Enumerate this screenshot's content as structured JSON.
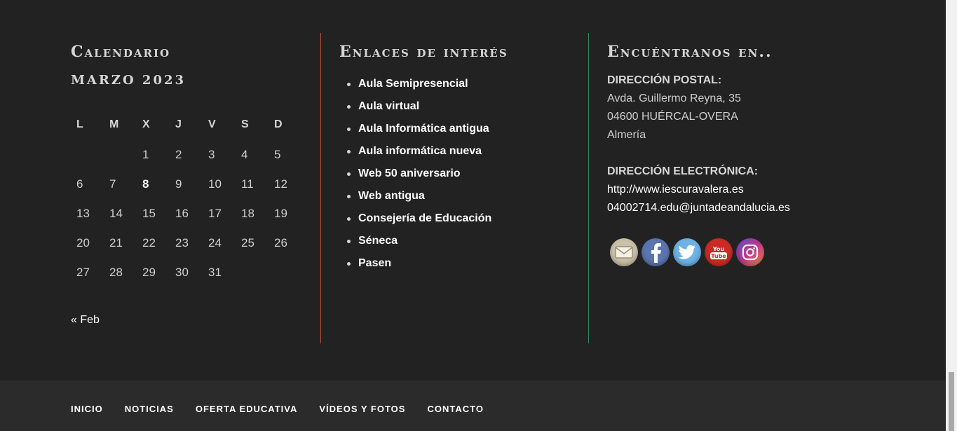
{
  "calendar": {
    "title": "Calendario",
    "caption": "MARZO 2023",
    "weekdays": [
      "L",
      "M",
      "X",
      "J",
      "V",
      "S",
      "D"
    ],
    "weeks": [
      [
        "",
        "",
        "1",
        "2",
        "3",
        "4",
        "5"
      ],
      [
        "6",
        "7",
        "8",
        "9",
        "10",
        "11",
        "12"
      ],
      [
        "13",
        "14",
        "15",
        "16",
        "17",
        "18",
        "19"
      ],
      [
        "20",
        "21",
        "22",
        "23",
        "24",
        "25",
        "26"
      ],
      [
        "27",
        "28",
        "29",
        "30",
        "31",
        "",
        ""
      ]
    ],
    "today": "8",
    "prev_link": "« Feb"
  },
  "links": {
    "title": "Enlaces de interés",
    "items": [
      "Aula Semipresencial",
      "Aula virtual",
      "Aula Informática antigua",
      "Aula informática nueva",
      "Web 50 aniversario",
      "Web antigua",
      "Consejería de Educación",
      "Séneca",
      "Pasen"
    ]
  },
  "find": {
    "title": "Encuéntranos en..",
    "postal_label": "DIRECCIÓN POSTAL:",
    "postal_lines": [
      "Avda. Guillermo Reyna, 35",
      "04600 HUÉRCAL-OVERA",
      "Almería"
    ],
    "email_label": "DIRECCIÓN ELECTRÓNICA:",
    "web": "http://www.iescuravalera.es",
    "email": "04002714.edu@juntadeandalucia.es",
    "social_icons": [
      "email-icon",
      "facebook-icon",
      "twitter-icon",
      "youtube-icon",
      "instagram-icon"
    ]
  },
  "bottom_nav": [
    "INICIO",
    "NOTICIAS",
    "OFERTA EDUCATIVA",
    "VÍDEOS Y FOTOS",
    "CONTACTO"
  ],
  "colors": {
    "background": "#222222",
    "bottom_bar": "#2b2b2b",
    "links_divider": "#b5523b",
    "find_divider": "#2f8a62"
  }
}
